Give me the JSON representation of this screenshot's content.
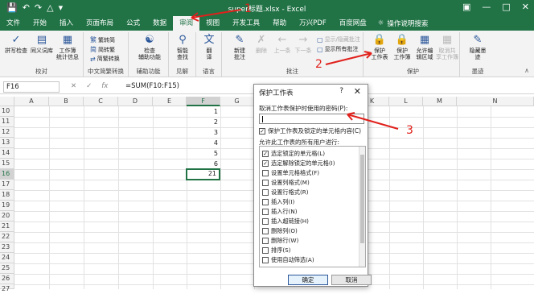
{
  "app": {
    "title": "super标题.xlsx  -  Excel",
    "qat_icons": [
      "save-icon",
      "undo-icon",
      "redo-icon",
      "paint-icon",
      "customize-icon"
    ],
    "window_buttons": [
      "ribbon-options-icon",
      "minimize-icon",
      "maximize-icon",
      "close-icon"
    ]
  },
  "tabs": [
    "文件",
    "开始",
    "插入",
    "页面布局",
    "公式",
    "数据",
    "审阅",
    "视图",
    "开发工具",
    "帮助",
    "万兴PDF",
    "百度网盘"
  ],
  "active_tab": "审阅",
  "tell_me": "操作说明搜索",
  "ribbon": {
    "proofing": {
      "label": "校对",
      "spell": "拼写检查",
      "thesaurus": "同义词库",
      "stats": "工作簿\n统计信息"
    },
    "chinese": {
      "label": "中文简繁转换",
      "to_trad": "繁转简",
      "to_simp": "简转繁",
      "convert": "简繁转换"
    },
    "access": {
      "label": "辅助功能",
      "check": "检查\n辅助功能"
    },
    "insights": {
      "label": "见解",
      "smart": "智能\n查找"
    },
    "language": {
      "label": "语言",
      "translate": "翻\n译"
    },
    "comments": {
      "label": "批注",
      "new": "新建\n批注",
      "delete": "删除",
      "prev": "上一条",
      "next": "下一条",
      "show_hide": "显示/隐藏批注",
      "show_all": "显示所有批注"
    },
    "protect": {
      "label": "保护",
      "sheet": "保护\n工作表",
      "workbook": "保护\n工作簿",
      "allow": "允许编\n辑区域",
      "unshare": "取消共\n享工作簿"
    },
    "ink": {
      "label": "墨迹",
      "hide": "隐藏墨\n迹"
    }
  },
  "formula_bar": {
    "name_box": "F16",
    "formula": "=SUM(F10:F15)"
  },
  "sheet": {
    "columns": [
      "A",
      "B",
      "C",
      "D",
      "E",
      "F",
      "G",
      "H",
      "I",
      "J",
      "K",
      "L",
      "M",
      "N"
    ],
    "rows": [
      "10",
      "11",
      "12",
      "13",
      "14",
      "15",
      "16",
      "17",
      "18",
      "19",
      "20",
      "21",
      "22",
      "23",
      "24",
      "25",
      "26",
      "27"
    ],
    "f_values": [
      "1",
      "2",
      "3",
      "4",
      "5",
      "6",
      "21"
    ]
  },
  "dialog": {
    "title": "保护工作表",
    "help": "?",
    "password_label": "取消工作表保护时使用的密码(P):",
    "protect_checkbox": "保护工作表及锁定的单元格内容(C)",
    "allow_label": "允许此工作表的所有用户进行:",
    "options": [
      {
        "label": "选定锁定的单元格(L)",
        "checked": true
      },
      {
        "label": "选定解除锁定的单元格(I)",
        "checked": true
      },
      {
        "label": "设置单元格格式(F)",
        "checked": false
      },
      {
        "label": "设置列格式(M)",
        "checked": false
      },
      {
        "label": "设置行格式(R)",
        "checked": false
      },
      {
        "label": "插入列(I)",
        "checked": false
      },
      {
        "label": "插入行(N)",
        "checked": false
      },
      {
        "label": "插入超链接(H)",
        "checked": false
      },
      {
        "label": "删除列(O)",
        "checked": false
      },
      {
        "label": "删除行(W)",
        "checked": false
      },
      {
        "label": "排序(S)",
        "checked": false
      },
      {
        "label": "使用自动筛选(A)",
        "checked": false
      }
    ],
    "ok": "确定",
    "cancel": "取消"
  },
  "annotations": {
    "one": "1",
    "two": "2",
    "three": "3",
    "color": "#e0201b"
  }
}
